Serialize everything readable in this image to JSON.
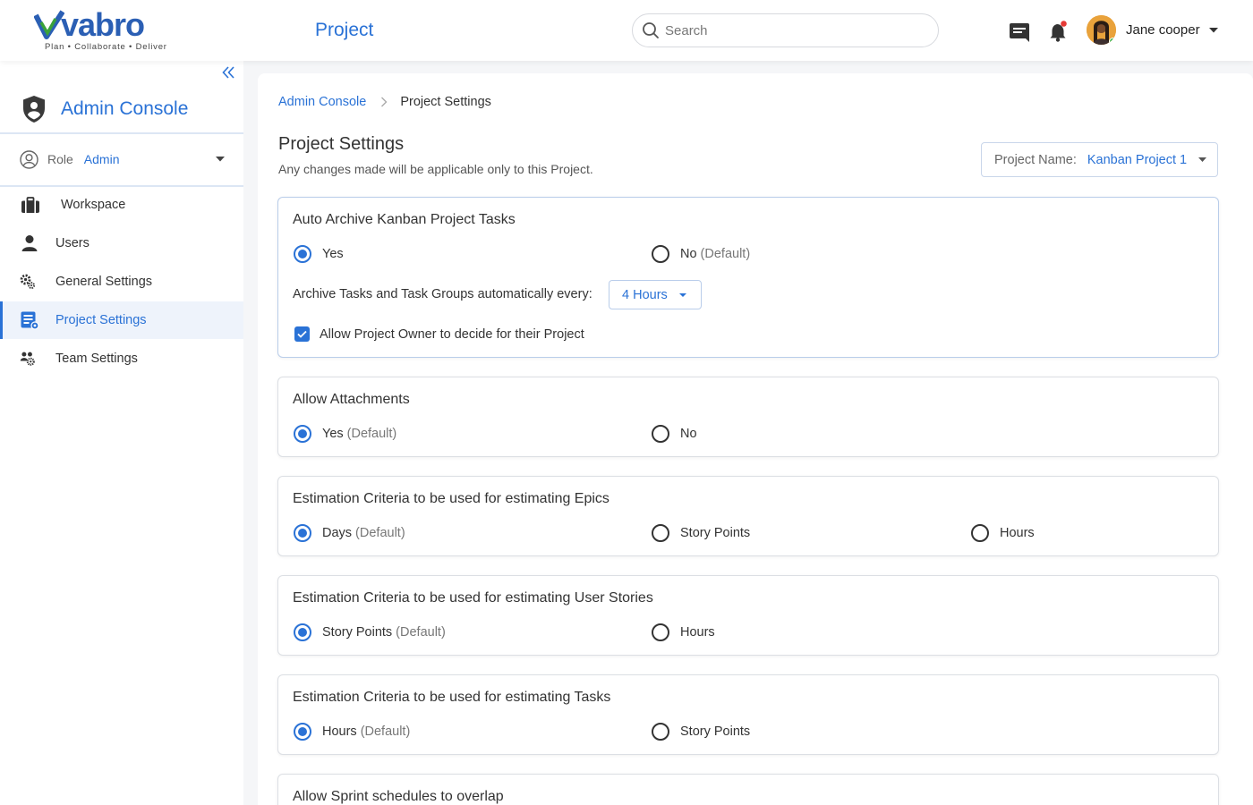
{
  "header": {
    "brand": "vabro",
    "tagline": "Plan • Collaborate • Deliver",
    "title": "Project",
    "search_placeholder": "Search",
    "user_name": "Jane cooper",
    "icons": [
      "inbox-icon",
      "bell-icon"
    ],
    "status": "online"
  },
  "sidebar": {
    "console_title": "Admin Console",
    "role_label": "Role",
    "role_value": "Admin",
    "items": [
      {
        "label": "Workspace",
        "icon": "briefcase-icon",
        "active": false
      },
      {
        "label": "Users",
        "icon": "user-icon",
        "active": false
      },
      {
        "label": "General Settings",
        "icon": "gear-icon",
        "active": false
      },
      {
        "label": "Project Settings",
        "icon": "project-settings-icon",
        "active": true
      },
      {
        "label": "Team Settings",
        "icon": "team-icon",
        "active": false
      }
    ]
  },
  "main": {
    "breadcrumb": {
      "parent": "Admin Console",
      "current": "Project Settings"
    },
    "title": "Project Settings",
    "subtitle": "Any changes made will be applicable only to this Project.",
    "project_label": "Project Name:",
    "project_value": "Kanban Project 1",
    "sections": {
      "archive": {
        "title": "Auto Archive Kanban Project Tasks",
        "opt_yes": "Yes",
        "opt_no": "No",
        "opt_no_default": "(Default)",
        "selected": "Yes",
        "interval_label": "Archive Tasks and Task Groups automatically every:",
        "interval_value": "4 Hours",
        "owner_label": "Allow Project Owner to decide for their Project",
        "owner_checked": true
      },
      "attachments": {
        "title": "Allow Attachments",
        "opt_yes": "Yes",
        "opt_yes_default": "(Default)",
        "opt_no": "No",
        "selected": "Yes"
      },
      "epics": {
        "title": "Estimation Criteria to be used for estimating Epics",
        "opt_days": "Days",
        "opt_days_default": "(Default)",
        "opt_points": "Story Points",
        "opt_hours": "Hours",
        "selected": "Days"
      },
      "stories": {
        "title": "Estimation Criteria to be used for estimating User Stories",
        "opt_points": "Story Points",
        "opt_points_default": "(Default)",
        "opt_hours": "Hours",
        "selected": "Story Points"
      },
      "tasks": {
        "title": "Estimation Criteria to be used for estimating Tasks",
        "opt_hours": "Hours",
        "opt_hours_default": "(Default)",
        "opt_points": "Story Points",
        "selected": "Hours"
      },
      "sprint": {
        "title": "Allow Sprint schedules to overlap"
      }
    }
  },
  "colors": {
    "accent": "#2a72d6",
    "brand_green": "#3aa23a",
    "notification": "#e53935"
  }
}
